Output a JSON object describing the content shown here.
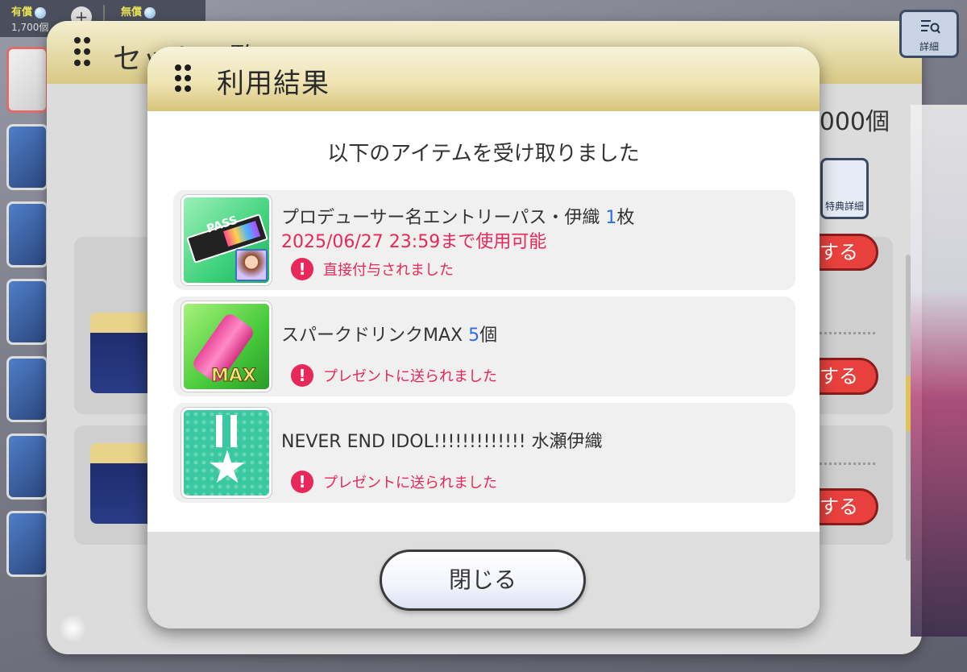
{
  "currency": {
    "paid_label": "有償",
    "paid_value": "1,700個",
    "free_label": "無償",
    "plus_symbol": "+"
  },
  "background": {
    "panel_title": "セット一覧",
    "count_text": "000個",
    "detail_label": "詳細",
    "bonus_detail_label": "特典詳細",
    "row_button_label": "する"
  },
  "dialog": {
    "title": "利用結果",
    "message": "以下のアイテムを受け取りました",
    "items": [
      {
        "name": "プロデューサー名エントリーパス・伊織",
        "qty": "1",
        "unit": "枚",
        "expiry": "2025/06/27 23:59まで使用可能",
        "notice": "直接付与されました",
        "icon": "entry-pass-icon"
      },
      {
        "name": "スパークドリンクMAX",
        "qty": "5",
        "unit": "個",
        "expiry": "",
        "notice": "プレゼントに送られました",
        "icon": "spark-drink-icon",
        "icon_text": "MAX"
      },
      {
        "name": "NEVER END IDOL!!!!!!!!!!!!! 水瀬伊織",
        "qty": "",
        "unit": "",
        "expiry": "",
        "notice": "プレゼントに送られました",
        "icon": "medal-icon"
      }
    ],
    "close_label": "閉じる"
  },
  "colors": {
    "accent_red": "#e8275b",
    "qty_blue": "#2c6fe0",
    "header_gold": "#d8c47c"
  },
  "icons": {
    "pass_word": "PASS",
    "alert": "!",
    "star": "★"
  }
}
